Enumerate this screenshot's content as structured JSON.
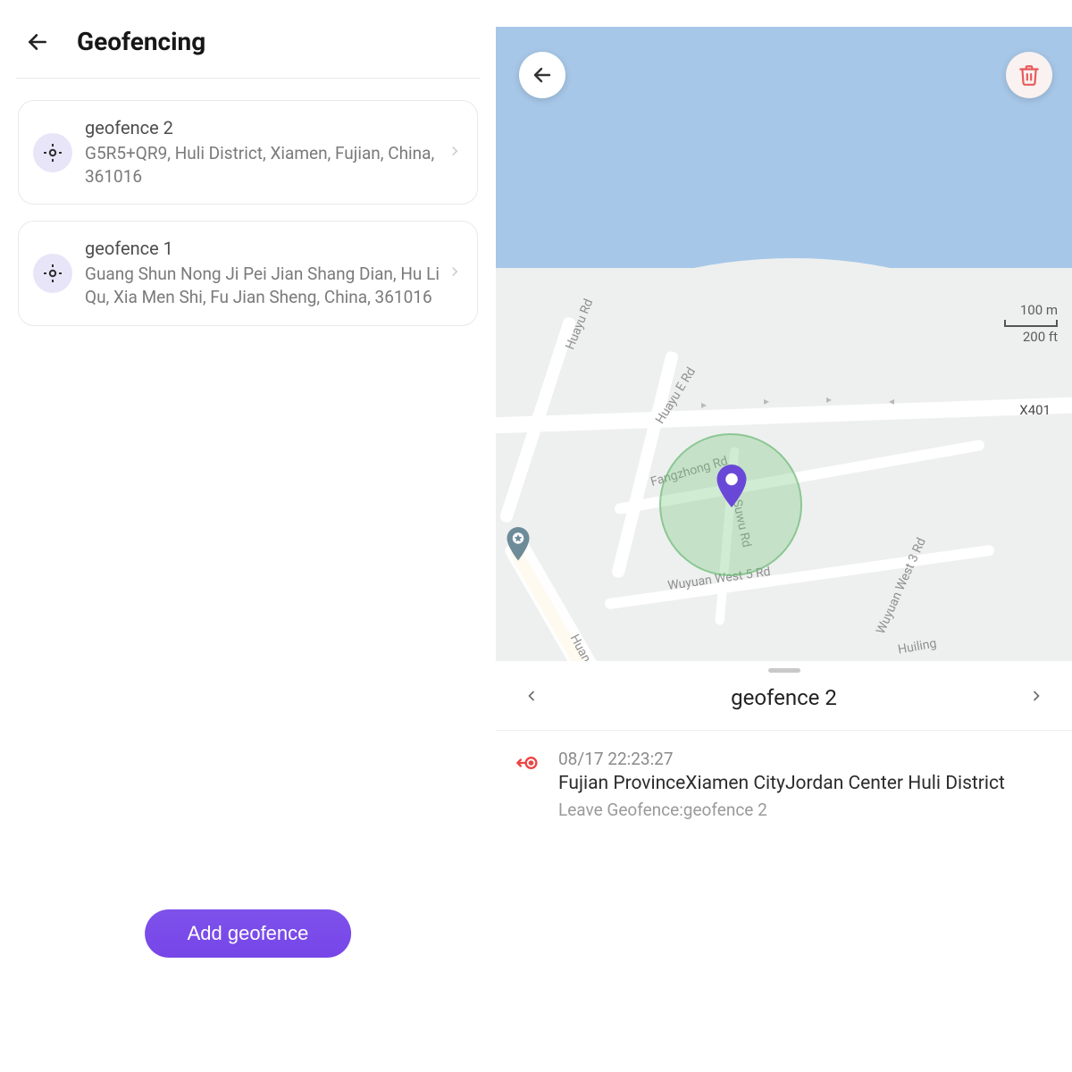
{
  "header": {
    "title": "Geofencing"
  },
  "geofences": [
    {
      "name": "geofence 2",
      "address": "G5R5+QR9, Huli District, Xiamen, Fujian, China, 361016"
    },
    {
      "name": "geofence 1",
      "address": "Guang Shun Nong Ji Pei Jian Shang Dian, Hu Li Qu, Xia Men Shi, Fu Jian Sheng, China, 361016"
    }
  ],
  "add_button": "Add geofence",
  "map": {
    "scale_metric": "100 m",
    "scale_imperial": "200 ft",
    "roads": {
      "huayu": "Huayu Rd",
      "huayu_e": "Huayu E Rd",
      "fangzhong": "Fangzhong Rd",
      "suwu": "Suwu Rd",
      "wuyuan_w5": "Wuyuan West 5 Rd",
      "wuyuan_w3": "Wuyuan West 3 Rd",
      "huiling": "Huiling",
      "huan": "Huan",
      "x401": "X401"
    }
  },
  "detail": {
    "title": "geofence 2",
    "event": {
      "timestamp": "08/17 22:23:27",
      "location": "Fujian ProvinceXiamen CityJordan Center Huli District",
      "message": "Leave Geofence:geofence 2"
    }
  }
}
